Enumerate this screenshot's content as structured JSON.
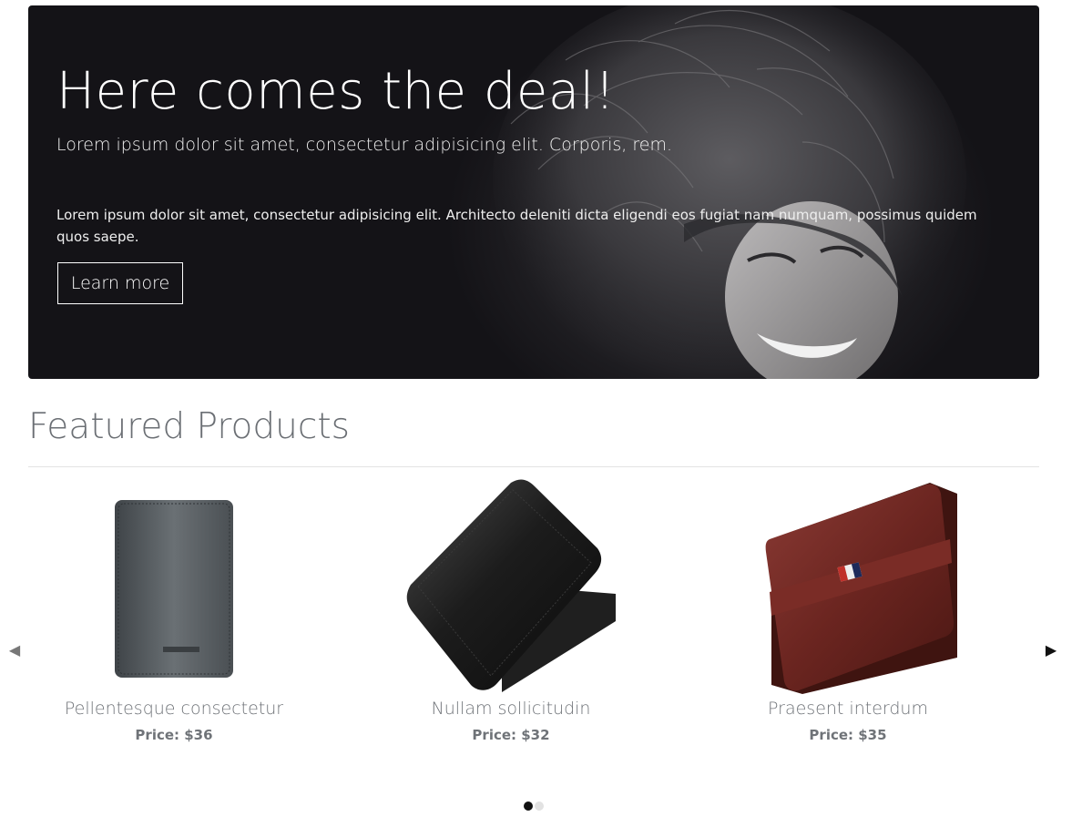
{
  "hero": {
    "title": "Here comes the deal!",
    "lead": "Lorem ipsum dolor sit amet, consectetur adipisicing elit. Corporis, rem.",
    "body": "Lorem ipsum dolor sit amet, consectetur adipisicing elit. Architecto deleniti dicta eligendi eos fugiat nam numquam, possimus quidem quos saepe.",
    "button_label": "Learn more"
  },
  "featured": {
    "title": "Featured Products",
    "prev_icon": "◀",
    "next_icon": "▶",
    "products": [
      {
        "name": "Pellentesque consectetur",
        "price": "Price: $36",
        "image": "grey-wallet-image"
      },
      {
        "name": "Nullam sollicitudin",
        "price": "Price: $32",
        "image": "black-wallet-image"
      },
      {
        "name": "Praesent interdum",
        "price": "Price: $35",
        "image": "brown-wallet-image"
      }
    ],
    "page_count": 2,
    "active_page": 1
  },
  "colors": {
    "hero_background": "#18171b",
    "section_title": "#6b6f74",
    "active_dot": "#111111",
    "inactive_dot": "#e2e2e2"
  }
}
